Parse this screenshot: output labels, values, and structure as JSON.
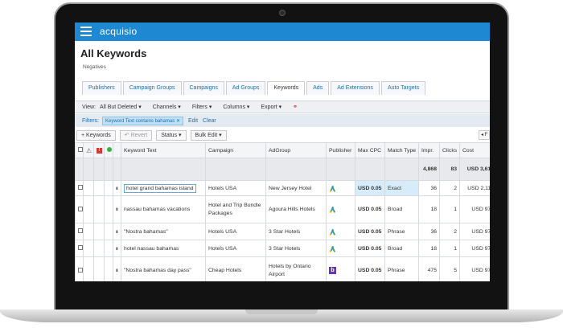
{
  "app": {
    "brand": "acquisio"
  },
  "page": {
    "title": "All Keywords",
    "subtitle": "Negatives"
  },
  "tabs": [
    "Publishers",
    "Campaign Groups",
    "Campaigns",
    "Ad Groups",
    "Keywords",
    "Ads",
    "Ad Extensions",
    "Auto Targets"
  ],
  "active_tab": "Keywords",
  "viewbar": {
    "view_label": "View:",
    "view_value": "All But Deleted ▾",
    "channels": "Channels ▾",
    "filters": "Filters ▾",
    "columns": "Columns ▾",
    "export": "Export ▾"
  },
  "filterbar": {
    "label": "Filters:",
    "chip": "Keyword Text contains bahamas ✕",
    "edit": "Edit",
    "clear": "Clear"
  },
  "actions": {
    "add": "+ Keywords",
    "revert": "↶ Revert",
    "status": "Status ▾",
    "bulk_edit": "Bulk Edit ▾",
    "right": "◂ F"
  },
  "table": {
    "headers": {
      "keyword": "Keyword Text",
      "campaign": "Campaign",
      "adgroup": "AdGroup",
      "publisher": "Publisher",
      "max_cpc": "Max CPC",
      "match_type": "Match Type",
      "impr": "Impr.",
      "clicks": "Clicks",
      "cost": "Cost"
    },
    "totals": {
      "impr": "4,868",
      "clicks": "83",
      "cost": "USD 3,610"
    },
    "rows": [
      {
        "keyword": "hotel grand bahamas island",
        "campaign": "Hotels USA",
        "adgroup": "New Jersey Hotel",
        "publisher": "google",
        "max_cpc": "USD 0.05",
        "match_type": "Exact",
        "impr": "36",
        "clicks": "2",
        "cost": "USD 2,112"
      },
      {
        "keyword": "nassau bahamas vacations",
        "campaign": "Hotel and Trip Bundle Packages",
        "adgroup": "Agoura Hills Hotels",
        "publisher": "google",
        "max_cpc": "USD 0.05",
        "match_type": "Broad",
        "impr": "18",
        "clicks": "1",
        "cost": "USD 976"
      },
      {
        "keyword": "\"Nostra bahamas\"",
        "campaign": "Hotels USA",
        "adgroup": "3 Star Hotels",
        "publisher": "google",
        "max_cpc": "USD 0.05",
        "match_type": "Phrase",
        "impr": "36",
        "clicks": "2",
        "cost": "USD 976"
      },
      {
        "keyword": "hotel nassau bahamas",
        "campaign": "Hotels USA",
        "adgroup": "3 Star Hotels",
        "publisher": "google",
        "max_cpc": "USD 0.05",
        "match_type": "Broad",
        "impr": "18",
        "clicks": "1",
        "cost": "USD 976"
      },
      {
        "keyword": "\"Nostra bahamas day pass\"",
        "campaign": "Cheap Hotels",
        "adgroup": "Hotels by Ontario Airport",
        "publisher": "bing",
        "max_cpc": "USD 0.05",
        "match_type": "Phrase",
        "impr": "475",
        "clicks": "5",
        "cost": "USD 976"
      }
    ]
  },
  "colors": {
    "topbar": "#1e88d2",
    "link": "#1e6fb0",
    "highlight": "#d6ecfa"
  },
  "icons": [
    "menu-icon",
    "warning-icon",
    "error-icon",
    "status-dot-icon",
    "pause-icon",
    "google-ads-icon",
    "bing-icon"
  ]
}
